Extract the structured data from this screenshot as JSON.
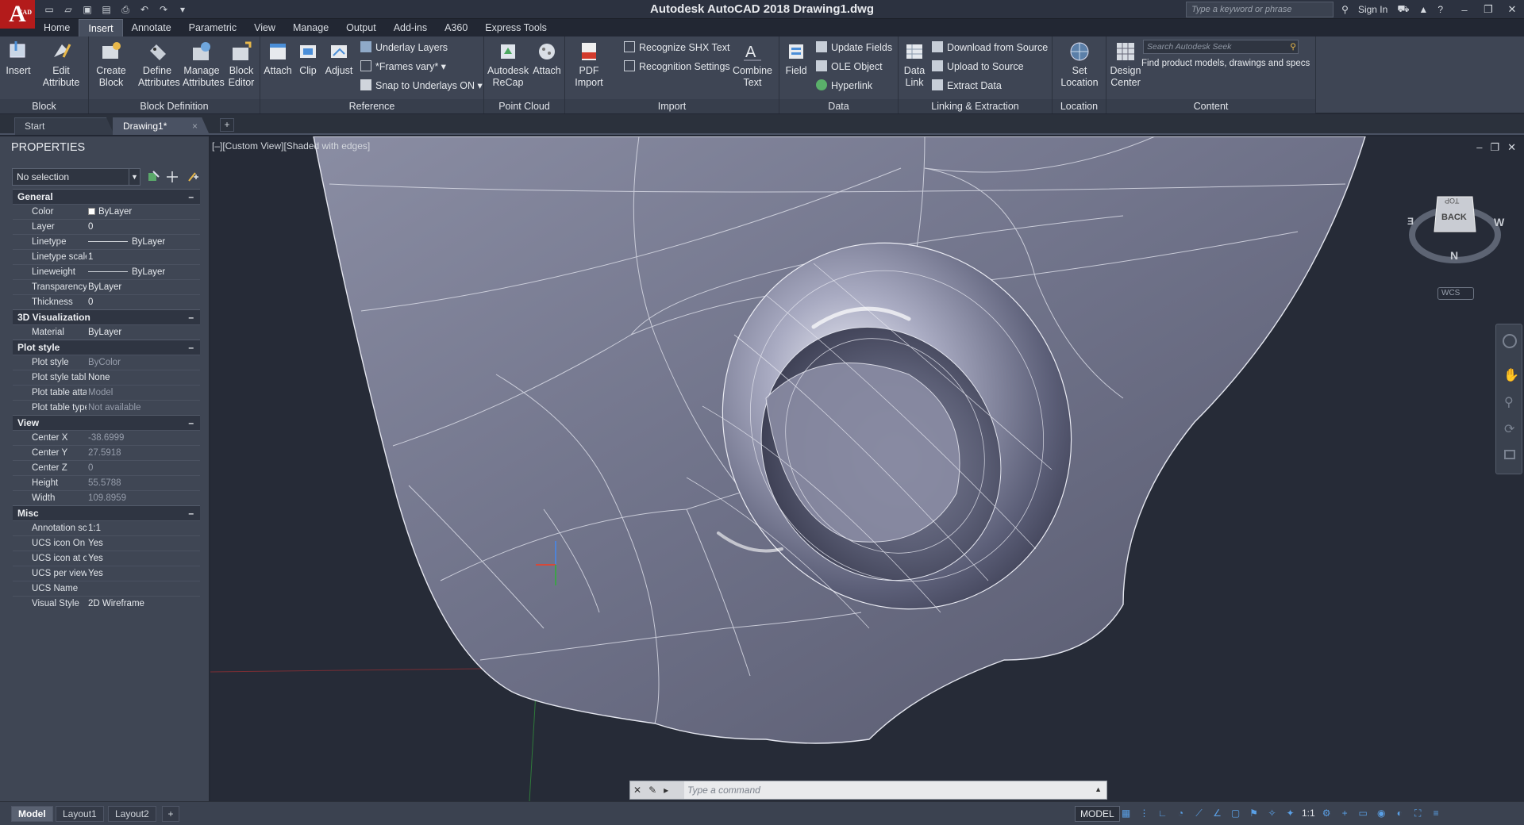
{
  "app": {
    "logo_letter": "A",
    "logo_sub": "CAD",
    "title": "Autodesk AutoCAD 2018    Drawing1.dwg",
    "search_placeholder": "Type a keyword or phrase",
    "sign_in": "Sign In"
  },
  "ribbon_tabs": [
    "Home",
    "Insert",
    "Annotate",
    "Parametric",
    "View",
    "Manage",
    "Output",
    "Add-ins",
    "A360",
    "Express Tools"
  ],
  "active_ribbon_tab": "Insert",
  "ribbon": {
    "block": {
      "label": "Block",
      "insert": "Insert",
      "edit_attribute": "Edit Attribute"
    },
    "block_definition": {
      "label": "Block Definition",
      "create_block": "Create Block",
      "define_attributes": "Define Attributes",
      "manage_attributes": "Manage Attributes",
      "block_editor": "Block Editor"
    },
    "reference": {
      "label": "Reference",
      "attach": "Attach",
      "clip": "Clip",
      "adjust": "Adjust",
      "underlay_layers": "Underlay Layers",
      "frames_vary": "*Frames vary*",
      "snap_to_underlays": "Snap to Underlays ON"
    },
    "point_cloud": {
      "label": "Point Cloud",
      "recap": "Autodesk ReCap",
      "attach": "Attach"
    },
    "import": {
      "label": "Import",
      "pdf_import": "PDF Import",
      "recognize_shx": "Recognize SHX Text",
      "recognition_settings": "Recognition Settings",
      "combine_text": "Combine Text"
    },
    "data": {
      "label": "Data",
      "field": "Field",
      "update_fields": "Update Fields",
      "ole_object": "OLE Object",
      "hyperlink": "Hyperlink"
    },
    "linking": {
      "label": "Linking & Extraction",
      "data_link": "Data Link",
      "download_from_source": "Download from Source",
      "upload_to_source": "Upload to Source",
      "extract_data": "Extract  Data"
    },
    "location": {
      "label": "Location",
      "set_location": "Set Location"
    },
    "content": {
      "label": "Content",
      "design_center": "Design Center",
      "seek_placeholder": "Search Autodesk Seek",
      "seek_text": "Find product models, drawings and specs"
    }
  },
  "file_tabs": {
    "start": "Start",
    "drawing": "Drawing1*"
  },
  "properties": {
    "title": "PROPERTIES",
    "selection": "No selection",
    "sections": [
      {
        "name": "General",
        "toggle": "–",
        "rows": [
          {
            "key": "Color",
            "value": "ByLayer",
            "style": "swatch"
          },
          {
            "key": "Layer",
            "value": "0"
          },
          {
            "key": "Linetype",
            "value": "ByLayer",
            "style": "line"
          },
          {
            "key": "Linetype scale",
            "value": "1"
          },
          {
            "key": "Lineweight",
            "value": "ByLayer",
            "style": "line"
          },
          {
            "key": "Transparency",
            "value": "ByLayer"
          },
          {
            "key": "Thickness",
            "value": "0"
          }
        ]
      },
      {
        "name": "3D Visualization",
        "toggle": "–",
        "rows": [
          {
            "key": "Material",
            "value": "ByLayer"
          }
        ]
      },
      {
        "name": "Plot style",
        "toggle": "–",
        "rows": [
          {
            "key": "Plot style",
            "value": "ByColor",
            "dim": true
          },
          {
            "key": "Plot style table",
            "value": "None"
          },
          {
            "key": "Plot table atta...",
            "value": "Model",
            "dim": true
          },
          {
            "key": "Plot table type",
            "value": "Not available",
            "dim": true
          }
        ]
      },
      {
        "name": "View",
        "toggle": "–",
        "rows": [
          {
            "key": "Center X",
            "value": "-38.6999",
            "dim": true
          },
          {
            "key": "Center Y",
            "value": "27.5918",
            "dim": true
          },
          {
            "key": "Center Z",
            "value": "0",
            "dim": true
          },
          {
            "key": "Height",
            "value": "55.5788",
            "dim": true
          },
          {
            "key": "Width",
            "value": "109.8959",
            "dim": true
          }
        ]
      },
      {
        "name": "Misc",
        "toggle": "–",
        "rows": [
          {
            "key": "Annotation sc...",
            "value": "1:1"
          },
          {
            "key": "UCS icon On",
            "value": "Yes"
          },
          {
            "key": "UCS icon at or...",
            "value": "Yes"
          },
          {
            "key": "UCS per viewp...",
            "value": "Yes"
          },
          {
            "key": "UCS Name",
            "value": ""
          },
          {
            "key": "Visual Style",
            "value": "2D Wireframe"
          }
        ]
      }
    ]
  },
  "viewport": {
    "label": "[–][Custom View][Shaded with edges]",
    "viewcube": {
      "top": "TOP",
      "face": "BACK",
      "n": "N",
      "e": "E",
      "w": "W"
    },
    "wcs": "WCS"
  },
  "command_line": {
    "placeholder": "Type  a  command"
  },
  "layout_tabs": [
    "Model",
    "Layout1",
    "Layout2"
  ],
  "status": {
    "model": "MODEL",
    "scale": "1:1"
  },
  "colors": {
    "accent": "#1d8fe0",
    "logo_red": "#b31b1b",
    "panel": "#3e4554",
    "viewport": "#262b37"
  }
}
